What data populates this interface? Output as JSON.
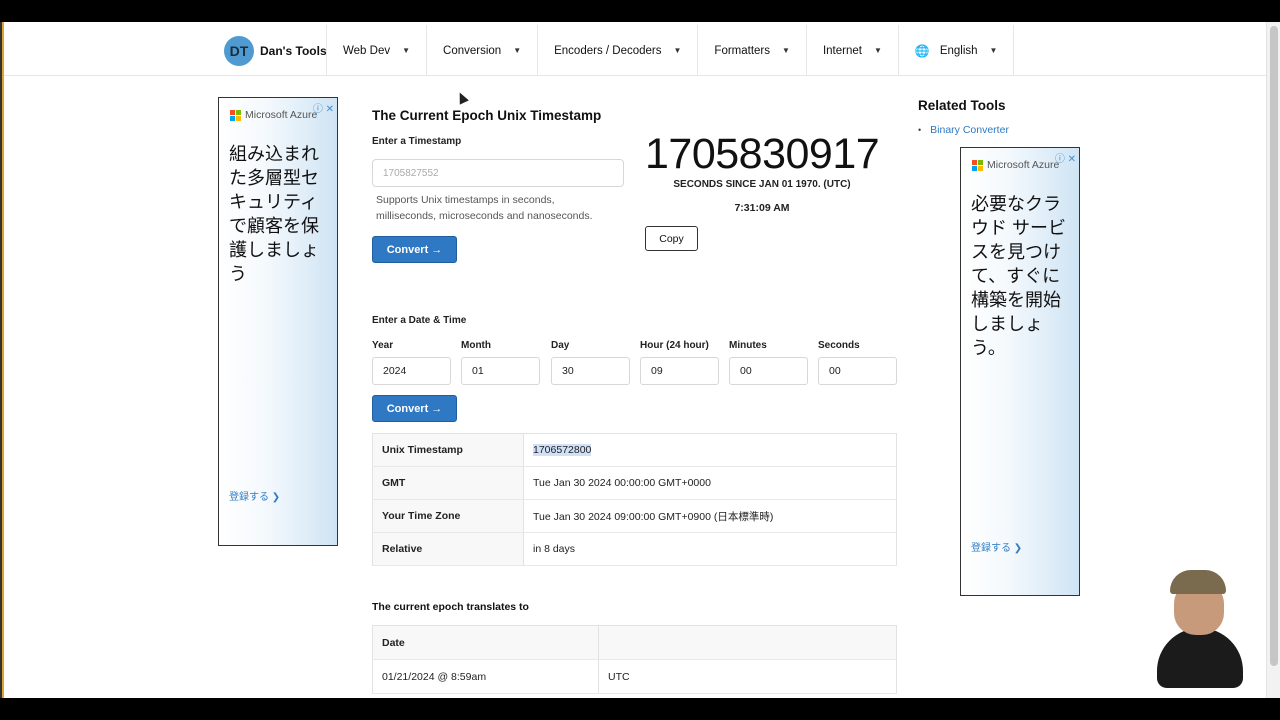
{
  "nav": {
    "logo": "DT",
    "brand": "Dan's Tools",
    "items": [
      "Web Dev",
      "Conversion",
      "Encoders / Decoders",
      "Formatters",
      "Internet"
    ],
    "language": "English"
  },
  "ads": {
    "left": {
      "brand": "Microsoft Azure",
      "text": "組み込まれた多層型セキュリティで顧客を保護しましょう",
      "cta": "登録する ❯"
    },
    "right": {
      "brand": "Microsoft Azure",
      "text": "必要なクラウド サービスを見つけて、すぐに構築を開始しましょう。",
      "cta": "登録する ❯"
    }
  },
  "converter": {
    "title": "The Current Epoch Unix Timestamp",
    "enter_label": "Enter a Timestamp",
    "input_placeholder": "1705827552",
    "hint": "Supports Unix timestamps in seconds, milliseconds, microseconds and nanoseconds.",
    "convert_label": "Convert →"
  },
  "current": {
    "timestamp": "1705830917",
    "since": "SECONDS SINCE JAN 01 1970. (UTC)",
    "time": "7:31:09 AM",
    "copy_label": "Copy"
  },
  "datetime": {
    "title": "Enter a Date & Time",
    "fields": [
      {
        "label": "Year",
        "value": "2024"
      },
      {
        "label": "Month",
        "value": "01"
      },
      {
        "label": "Day",
        "value": "30"
      },
      {
        "label": "Hour (24 hour)",
        "value": "09"
      },
      {
        "label": "Minutes",
        "value": "00"
      },
      {
        "label": "Seconds",
        "value": "00"
      }
    ],
    "convert_label": "Convert →"
  },
  "result": [
    {
      "key": "Unix Timestamp",
      "value": "1706572800"
    },
    {
      "key": "GMT",
      "value": "Tue Jan 30 2024 00:00:00 GMT+0000"
    },
    {
      "key": "Your Time Zone",
      "value": "Tue Jan 30 2024 09:00:00 GMT+0900 (日本標準時)"
    },
    {
      "key": "Relative",
      "value": "in 8 days"
    }
  ],
  "translates": {
    "title": "The current epoch translates to",
    "header": [
      "Date",
      ""
    ],
    "rows": [
      {
        "date": "01/21/2024 @ 8:59am",
        "zone": "UTC"
      }
    ]
  },
  "related": {
    "title": "Related Tools",
    "items": [
      "Binary Converter"
    ]
  },
  "colors": {
    "accent": "#2e78c4",
    "logo": "#4f9bd1"
  }
}
